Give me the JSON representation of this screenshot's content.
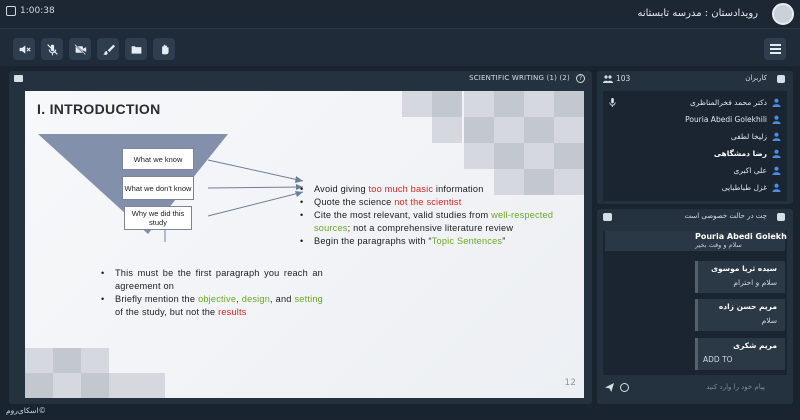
{
  "session": {
    "timer": "1:00:38",
    "room_title": "رویدادستان : مدرسه تابستانه"
  },
  "toolbar": {
    "buttons": [
      {
        "name": "speaker-off-button",
        "icon": "speaker-muted-icon"
      },
      {
        "name": "mic-off-button",
        "icon": "mic-muted-icon"
      },
      {
        "name": "camera-off-button",
        "icon": "camera-muted-icon"
      },
      {
        "name": "whiteboard-button",
        "icon": "brush-icon"
      },
      {
        "name": "files-button",
        "icon": "folder-icon"
      },
      {
        "name": "raise-hand-button",
        "icon": "hand-icon"
      }
    ],
    "menu_icon": "hamburger-icon"
  },
  "presentation": {
    "title": "SCIENTIFIC WRITING (1) (2)",
    "help_label": "?",
    "slide": {
      "heading": "I. INTRODUCTION",
      "funnel_boxes": [
        "What we know",
        "What we don't know",
        "Why we did this study"
      ],
      "right_bullets": [
        [
          {
            "t": "Avoid giving "
          },
          {
            "t": "too much basic",
            "c": "red"
          },
          {
            "t": " information"
          }
        ],
        [
          {
            "t": "Quote the science "
          },
          {
            "t": "not the scientist",
            "c": "red"
          }
        ],
        [
          {
            "t": "Cite the most relevant, valid studies from "
          },
          {
            "t": "well-respected sources",
            "c": "green"
          },
          {
            "t": "; not a comprehensive literature review"
          }
        ],
        [
          {
            "t": "Begin the paragraphs with “"
          },
          {
            "t": "Topic Sentences",
            "c": "green"
          },
          {
            "t": "”"
          }
        ]
      ],
      "left_bullets": [
        [
          {
            "t": "This must be the first paragraph you reach an agreement on"
          }
        ],
        [
          {
            "t": "Briefly mention the "
          },
          {
            "t": "objective",
            "c": "green"
          },
          {
            "t": ", "
          },
          {
            "t": "design",
            "c": "green"
          },
          {
            "t": ", and "
          },
          {
            "t": "setting",
            "c": "green"
          },
          {
            "t": " of the study, but not the "
          },
          {
            "t": "results",
            "c": "red"
          }
        ]
      ],
      "page_number": "12"
    }
  },
  "users_panel": {
    "title": "کاربران",
    "count": "103",
    "users": [
      {
        "name": "دکتر محمد فخرالمناظری",
        "bold": false,
        "mic": true
      },
      {
        "name": "Pouria Abedi Golekhili",
        "bold": false,
        "mic": false
      },
      {
        "name": "زلیخا لطفی",
        "bold": false,
        "mic": false
      },
      {
        "name": "رضا دمشگاهی",
        "bold": true,
        "mic": false
      },
      {
        "name": "علی اکبری",
        "bold": false,
        "mic": false
      },
      {
        "name": "غزل طباطبایی",
        "bold": false,
        "mic": false
      }
    ]
  },
  "chat_panel": {
    "title": "چت در حالت خصوصی است",
    "first_message": {
      "sender": "Pouria Abedi Golekhili",
      "text": "سلام و وقت بخیر"
    },
    "messages": [
      {
        "sender": "سیده ثریا موسوی",
        "text": "سلام و احترام"
      },
      {
        "sender": "مریم حسن زاده",
        "text": "سلام"
      },
      {
        "sender": "مریم شکری",
        "text": "ADD TO"
      }
    ],
    "input_placeholder": "پیام خود را وارد کنید"
  },
  "footer": {
    "brand": "©اسکای‌روم"
  },
  "colors": {
    "background": "#1a2430",
    "panel": "#24313f",
    "accent_red": "#d32727",
    "accent_green": "#6aa826",
    "user_icon": "#4a90e2"
  }
}
